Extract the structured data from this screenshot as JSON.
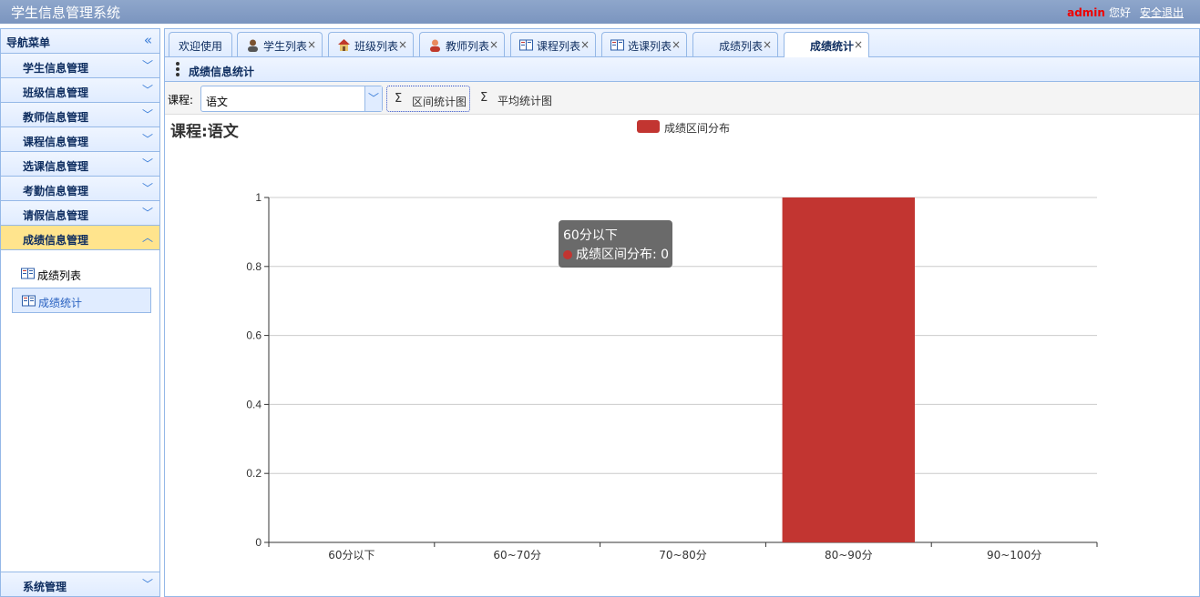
{
  "header": {
    "app_title": "学生信息管理系统",
    "user": "admin",
    "greeting": "您好",
    "logout": "安全退出"
  },
  "sidebar": {
    "title": "导航菜单",
    "sections": [
      {
        "label": "学生信息管理"
      },
      {
        "label": "班级信息管理"
      },
      {
        "label": "教师信息管理"
      },
      {
        "label": "课程信息管理"
      },
      {
        "label": "选课信息管理"
      },
      {
        "label": "考勤信息管理"
      },
      {
        "label": "请假信息管理"
      },
      {
        "label": "成绩信息管理"
      }
    ],
    "active_section": "成绩信息管理",
    "sub_items": [
      {
        "label": "成绩列表",
        "icon": "book-icon"
      },
      {
        "label": "成绩统计",
        "icon": "book-icon"
      }
    ],
    "system": "系统管理"
  },
  "tabs": [
    {
      "label": "欢迎使用",
      "icon": "",
      "closable": false
    },
    {
      "label": "学生列表",
      "icon": "user-icon",
      "closable": true
    },
    {
      "label": "班级列表",
      "icon": "house-icon",
      "closable": true
    },
    {
      "label": "教师列表",
      "icon": "teacher-icon",
      "closable": true
    },
    {
      "label": "课程列表",
      "icon": "book-icon",
      "closable": true
    },
    {
      "label": "选课列表",
      "icon": "book-icon",
      "closable": true
    },
    {
      "label": "成绩列表",
      "icon": "",
      "closable": true
    },
    {
      "label": "成绩统计",
      "icon": "",
      "closable": true
    }
  ],
  "active_tab": "成绩统计",
  "panel": {
    "title": "成绩信息统计"
  },
  "toolbar": {
    "course_label": "课程:",
    "course_value": "语文",
    "btn_range": "区间统计图",
    "btn_avg": "平均统计图"
  },
  "colors": {
    "bar": "#c23531",
    "accent": "#95b8e7"
  },
  "tooltip": {
    "title": "60分以下",
    "line": "成绩区间分布: 0"
  },
  "chart_data": {
    "type": "bar",
    "title": "课程:语文",
    "categories": [
      "60分以下",
      "60~70分",
      "70~80分",
      "80~90分",
      "90~100分"
    ],
    "series": [
      {
        "name": "成绩区间分布",
        "values": [
          0,
          0,
          0,
          1,
          0
        ]
      }
    ],
    "ylim": [
      0,
      1
    ],
    "yticks": [
      0,
      0.2,
      0.4,
      0.6,
      0.8,
      1
    ],
    "grid": true,
    "legend": "top-center"
  }
}
